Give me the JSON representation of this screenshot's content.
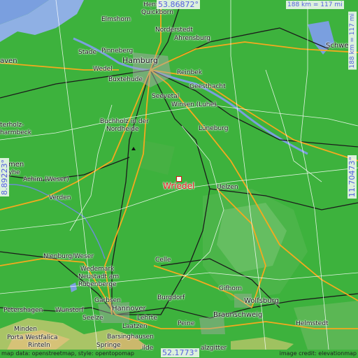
{
  "map": {
    "target": {
      "name": "Wriedel"
    },
    "coords": {
      "north": "53.86872°",
      "south": "52.1773°",
      "west": "8.89223°",
      "east": "11.70473°"
    },
    "scale": {
      "horizontal": "188 km = 117 mi",
      "vertical": "188 km = 117 mi"
    },
    "places": {
      "hamburg": "Hamburg",
      "hannover": "Hannover",
      "braunschweig": "Braunschweig",
      "wolfsburg": "Wolfsburg",
      "lueneburg": "Lüneburg",
      "uelzen": "Uelzen",
      "celle": "Celle",
      "gifhorn": "Gifhorn",
      "seevetal": "Seevetal",
      "winsen": "Winsen (Luhe)",
      "geesthacht": "Geesthacht",
      "reinbek": "Reinbek",
      "buxtehude": "Buxtehude",
      "wedel": "Wedel",
      "pinneberg": "Pinneberg",
      "stade": "Stade",
      "elmshorn": "Elmshorn",
      "norderstedt": "Norderstedt",
      "ahrensburg": "Ahrensburg",
      "quickborn": "Quickborn",
      "henstedt": "Henst",
      "buchholz1": "Buchholz in der",
      "buchholz2": "Nordheide",
      "achim": "Achim (Weser)",
      "verden": "Verden",
      "nienburg": "Nienburg/Weser",
      "wedemark": "Wedemark",
      "neustadt1": "Neustadt am",
      "neustadt2": "Rübenberge",
      "garbsen": "Garbsen",
      "seelze": "Seelze",
      "lehrte": "Lehrte",
      "laatzen": "Laatzen",
      "peine": "Peine",
      "burgdorf": "Burgdorf",
      "petershagen": "Petershagen",
      "wunstorf": "Wunstorf",
      "minden": "Minden",
      "portawestfalica": "Porta Westfalica",
      "rinteln": "Rinteln",
      "barsinghausen": "Barsinghausen",
      "springe": "Springe",
      "helmstedt": "Helmstedt",
      "schwerin": "Schwe",
      "bremen": "men",
      "bremerhaven": "aven",
      "osterholz1": "terholz-",
      "osterholz2": "harmbeck",
      "weyhe": "yhe",
      "hildesheim": "ilde",
      "salzgitter": "alzgitter"
    },
    "attribution_left": "map data: openstreetmap, style: opentopomap",
    "attribution_right": "image credit: elevationmap"
  },
  "colors": {
    "lowland": "#3db23d",
    "upland": "#5fb95f",
    "hills": "#c8b86a",
    "water": "#7a9fdf",
    "road_major": "#f5a91e",
    "road_minor": "#ffffff",
    "rail": "#1b1b1b",
    "coord_text": "#5560e0",
    "target": "#e01414"
  }
}
